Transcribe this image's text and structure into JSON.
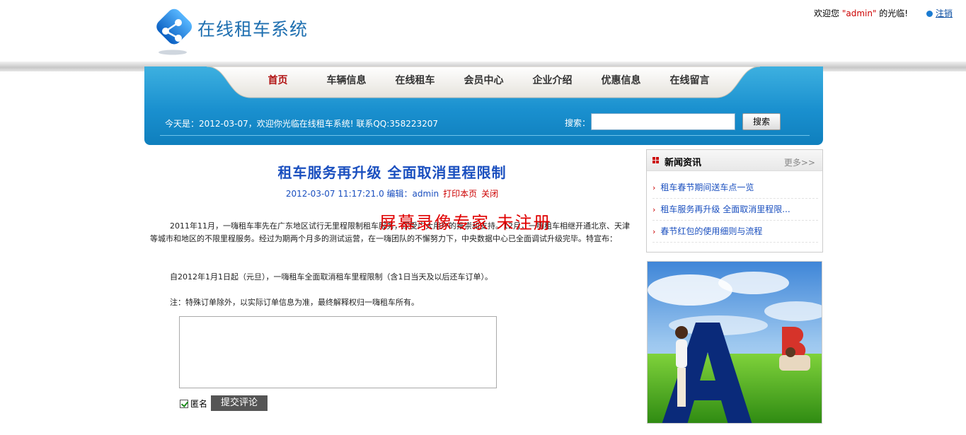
{
  "header": {
    "site_title": "在线租车系统",
    "welcome_prefix": "欢迎您 ",
    "username": "\"admin\"",
    "welcome_suffix": " 的光临!",
    "logout": "注销"
  },
  "nav": {
    "items": [
      {
        "label": "首页"
      },
      {
        "label": "车辆信息"
      },
      {
        "label": "在线租车"
      },
      {
        "label": "会员中心"
      },
      {
        "label": "企业介绍"
      },
      {
        "label": "优惠信息"
      },
      {
        "label": "在线留言"
      }
    ],
    "today": "今天是：2012-03-07，欢迎你光临在线租车系统! 联系QQ:358223207",
    "search_label": "搜索：",
    "search_value": "",
    "search_button": "搜索"
  },
  "article": {
    "title": "租车服务再升级 全面取消里程限制",
    "date": "2012-03-07 11:17:21.0",
    "author_label": " 编辑：",
    "author": "admin",
    "print": "打印本页",
    "close": "关闭",
    "watermark": "屏幕录像专家 未注册",
    "p1": "2011年11月，一嗨租车率先在广东地区试行无里程限制租车服务，深受广大用户的推崇和支持。12月，一嗨租车相继开通北京、天津等城市和地区的不限里程服务。经过为期两个月多的测试运营，在一嗨团队的不懈努力下，中央数据中心已全面调试升级完毕。特宣布：",
    "p2": "自2012年1月1日起（元旦），一嗨租车全面取消租车里程限制（含1日当天及以后还车订单）。",
    "p3": "注：特殊订单除外，以实际订单信息为准，最终解释权归一嗨租车所有。",
    "comment_value": "",
    "anonymous_label": "匿名",
    "submit": "提交评论"
  },
  "sidebar": {
    "news_title": "新闻资讯",
    "more": "更多>>",
    "news_items": [
      {
        "label": "租车春节期间送车点一览"
      },
      {
        "label": "租车服务再升级 全面取消里程限..."
      },
      {
        "label": "春节红包的使用细则与流程"
      }
    ]
  },
  "colors": {
    "brand_blue": "#1a90cf",
    "link_blue": "#1a4fbf",
    "accent_red": "#c00000"
  }
}
